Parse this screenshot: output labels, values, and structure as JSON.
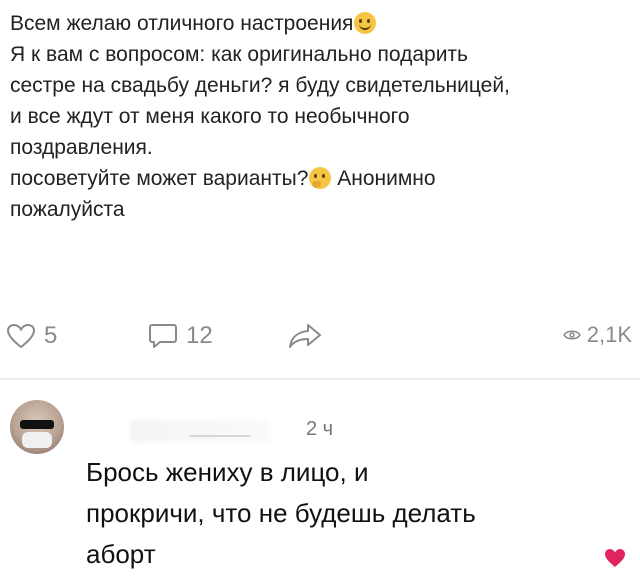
{
  "post": {
    "lines": [
      "Всем желаю отличного настроения",
      "Я к вам с вопросом: как оригинально подарить",
      "сестре на свадьбу деньги? я буду свидетельницей,",
      "и все ждут от меня какого то необычного",
      "поздравления.",
      "посоветуйте может варианты?",
      "Анонимно",
      "пожалуйста"
    ],
    "emoji": [
      "smiling-face",
      "thinking-face"
    ]
  },
  "actions": {
    "likes": "5",
    "comments": "12",
    "views": "2,1K"
  },
  "comment": {
    "time": "2 ч",
    "lines": [
      "Брось жениху в лицо, и",
      "прокричи, что не будешь делать",
      "аборт"
    ]
  },
  "colors": {
    "icon_gray": "#8a8a8a",
    "heart": "#e0245e",
    "emoji": "#f6c543"
  }
}
